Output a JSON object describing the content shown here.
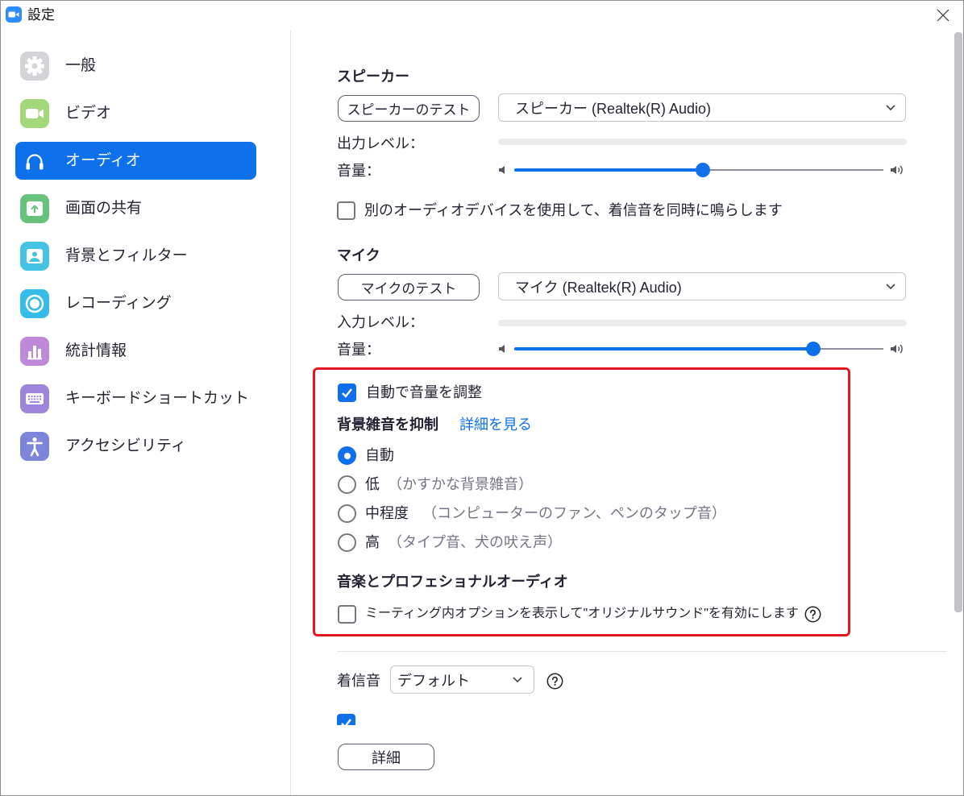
{
  "window": {
    "title": "設定",
    "app_icon": "zoom-camera-icon",
    "app_icon_color": "#2D8CFF",
    "close_icon": "close-icon"
  },
  "accent_color": "#0E71EB",
  "highlight_border_color": "#E5161D",
  "sidebar": {
    "selected_index": 2,
    "items": [
      {
        "label": "一般",
        "icon": "gear-icon",
        "color": "#D4D4D8"
      },
      {
        "label": "ビデオ",
        "icon": "video-camera-icon",
        "color": "#A3D87A"
      },
      {
        "label": "オーディオ",
        "icon": "headphones-icon"
      },
      {
        "label": "画面の共有",
        "icon": "share-screen-icon",
        "color": "#67C27B"
      },
      {
        "label": "背景とフィルター",
        "icon": "background-person-icon",
        "color": "#46C3E2"
      },
      {
        "label": "レコーディング",
        "icon": "record-icon",
        "color": "#35BCE8"
      },
      {
        "label": "統計情報",
        "icon": "bar-chart-icon",
        "color": "#BE89D6"
      },
      {
        "label": "キーボードショートカット",
        "icon": "keyboard-icon",
        "color": "#9C85DA"
      },
      {
        "label": "アクセシビリティ",
        "icon": "accessibility-icon",
        "color": "#7D85DA"
      }
    ]
  },
  "speaker": {
    "heading": "スピーカー",
    "test_button": "スピーカーのテスト",
    "device": "スピーカー (Realtek(R) Audio)",
    "level_label": "出力レベル：",
    "output_level": 0,
    "volume_label": "音量：",
    "volume": 0.51
  },
  "ring_separately": {
    "label": "別のオーディオデバイスを使用して、着信音を同時に鳴らします",
    "checked": false
  },
  "mic": {
    "heading": "マイク",
    "test_button": "マイクのテスト",
    "device": "マイク (Realtek(R) Audio)",
    "level_label": "入力レベル：",
    "input_level": 0,
    "volume_label": "音量：",
    "volume": 0.81
  },
  "auto_adjust": {
    "label": "自動で音量を調整",
    "checked": true
  },
  "noise": {
    "heading": "背景雑音を抑制",
    "link": "詳細を見る",
    "options": [
      {
        "label": "自動",
        "hint": "",
        "selected": true
      },
      {
        "label": "低",
        "hint": "（かすかな背景雑音）",
        "selected": false
      },
      {
        "label": "中程度",
        "hint": "（コンピューターのファン、ペンのタップ音）",
        "selected": false
      },
      {
        "label": "高",
        "hint": "（タイプ音、犬の吠え声）",
        "selected": false
      }
    ]
  },
  "music": {
    "heading": "音楽とプロフェショナルオーディオ",
    "original_sound": {
      "label": "ミーティング内オプションを表示して\"オリジナルサウンド\"を有効にします",
      "checked": false
    }
  },
  "ringtone": {
    "label": "着信音",
    "value": "デフォルト"
  },
  "partially_visible_option": {
    "checked": true
  },
  "advanced_button": "詳細"
}
